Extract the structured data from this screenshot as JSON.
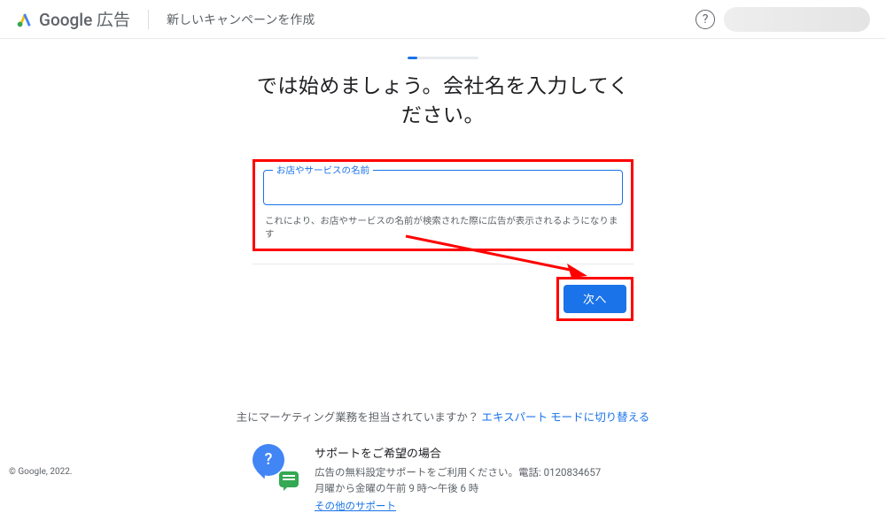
{
  "header": {
    "brand_1": "Google",
    "brand_2": "広告",
    "subtitle": "新しいキャンペーンを作成"
  },
  "main": {
    "heading": "では始めましょう。会社名を入力してください。",
    "field_label": "お店やサービスの名前",
    "field_value": "",
    "helper_text": "これにより、お店やサービスの名前が検索された際に広告が表示されるようになります",
    "next_button": "次へ"
  },
  "expert": {
    "question": "主にマーケティング業務を担当されていますか？ ",
    "link": "エキスパート モードに切り替える"
  },
  "support": {
    "title": "サポートをご希望の場合",
    "line1_pre": "広告の無料設定サポートをご利用ください。電話: ",
    "phone": "0120834657",
    "line2": "月曜から金曜の午前 9 時〜午後 6 時",
    "link": "その他のサポート"
  },
  "footer": {
    "copyright": "© Google, 2022."
  },
  "colors": {
    "primary": "#1a73e8",
    "annotation": "#ff0000"
  }
}
